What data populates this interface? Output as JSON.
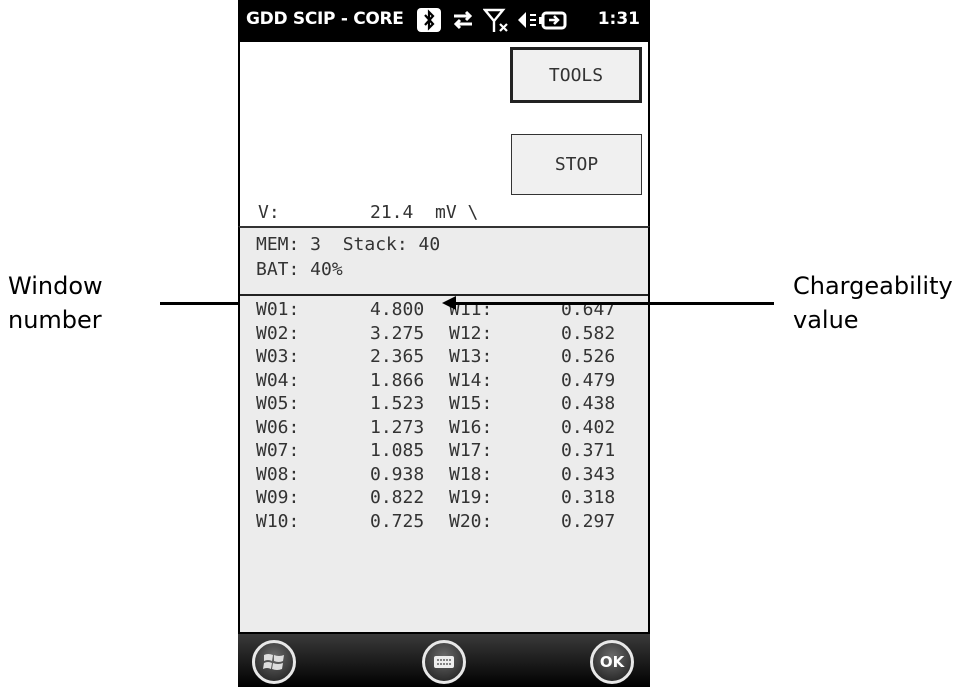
{
  "annotations": {
    "left_label_line1": "Window",
    "left_label_line2": "number",
    "right_label_line1": "Chargeability",
    "right_label_line2": "value"
  },
  "statusbar": {
    "title": "GDD SCIP - CORE",
    "time": "1:31",
    "icons": [
      "bluetooth-icon",
      "data-transfer-icon",
      "no-signal-icon",
      "speaker-muted-icon",
      "battery-charging-icon"
    ]
  },
  "buttons": {
    "tools": "TOOLS",
    "stop": "STOP"
  },
  "voltage": {
    "label": "V:",
    "value": "21.4  mV \\"
  },
  "status": {
    "mem_line": "MEM: 3  Stack: 40",
    "bat_line": "BAT: 40%"
  },
  "windows": [
    {
      "left_name": "W01:",
      "left_value": "4.800",
      "right_name": "W11:",
      "right_value": "0.647"
    },
    {
      "left_name": "W02:",
      "left_value": "3.275",
      "right_name": "W12:",
      "right_value": "0.582"
    },
    {
      "left_name": "W03:",
      "left_value": "2.365",
      "right_name": "W13:",
      "right_value": "0.526"
    },
    {
      "left_name": "W04:",
      "left_value": "1.866",
      "right_name": "W14:",
      "right_value": "0.479"
    },
    {
      "left_name": "W05:",
      "left_value": "1.523",
      "right_name": "W15:",
      "right_value": "0.438"
    },
    {
      "left_name": "W06:",
      "left_value": "1.273",
      "right_name": "W16:",
      "right_value": "0.402"
    },
    {
      "left_name": "W07:",
      "left_value": "1.085",
      "right_name": "W17:",
      "right_value": "0.371"
    },
    {
      "left_name": "W08:",
      "left_value": "0.938",
      "right_name": "W18:",
      "right_value": "0.343"
    },
    {
      "left_name": "W09:",
      "left_value": "0.822",
      "right_name": "W19:",
      "right_value": "0.318"
    },
    {
      "left_name": "W10:",
      "left_value": "0.725",
      "right_name": "W20:",
      "right_value": "0.297"
    }
  ],
  "taskbar": {
    "ok_label": "OK",
    "icons": [
      "windows-start-icon",
      "keyboard-icon"
    ]
  }
}
